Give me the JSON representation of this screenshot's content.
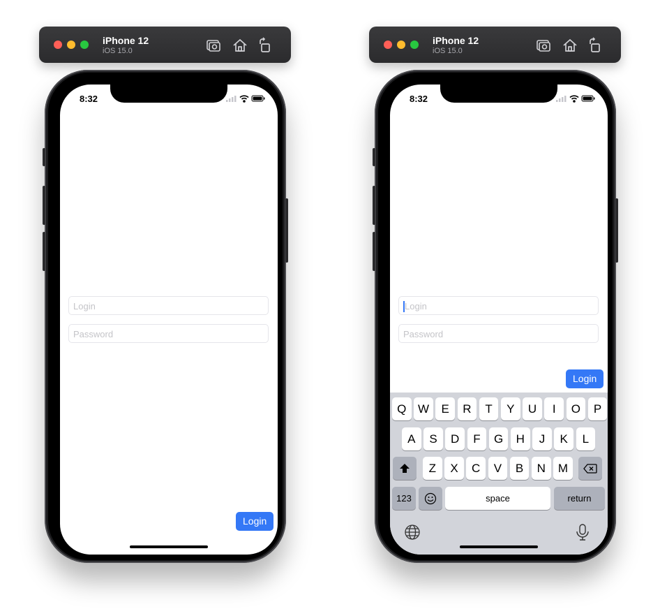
{
  "simulators": [
    {
      "device_name": "iPhone 12",
      "os_version": "iOS 15.0",
      "time": "8:32",
      "login_field": {
        "placeholder": "Login"
      },
      "password_field": {
        "placeholder": "Password"
      },
      "login_button": "Login",
      "keyboard_visible": false
    },
    {
      "device_name": "iPhone 12",
      "os_version": "iOS 15.0",
      "time": "8:32",
      "login_field": {
        "placeholder": "Login",
        "focused": true
      },
      "password_field": {
        "placeholder": "Password"
      },
      "login_button": "Login",
      "keyboard_visible": true
    }
  ],
  "keyboard": {
    "row1": [
      "Q",
      "W",
      "E",
      "R",
      "T",
      "Y",
      "U",
      "I",
      "O",
      "P"
    ],
    "row2": [
      "A",
      "S",
      "D",
      "F",
      "G",
      "H",
      "J",
      "K",
      "L"
    ],
    "row3": [
      "Z",
      "X",
      "C",
      "V",
      "B",
      "N",
      "M"
    ],
    "numbers_key": "123",
    "space_key": "space",
    "return_key": "return"
  },
  "toolbar_icons": [
    "screenshot-icon",
    "home-icon",
    "rotate-icon"
  ],
  "colors": {
    "accent": "#3478f6",
    "titlebar": "#2f2f31",
    "keyboard_bg": "#d2d4da"
  }
}
